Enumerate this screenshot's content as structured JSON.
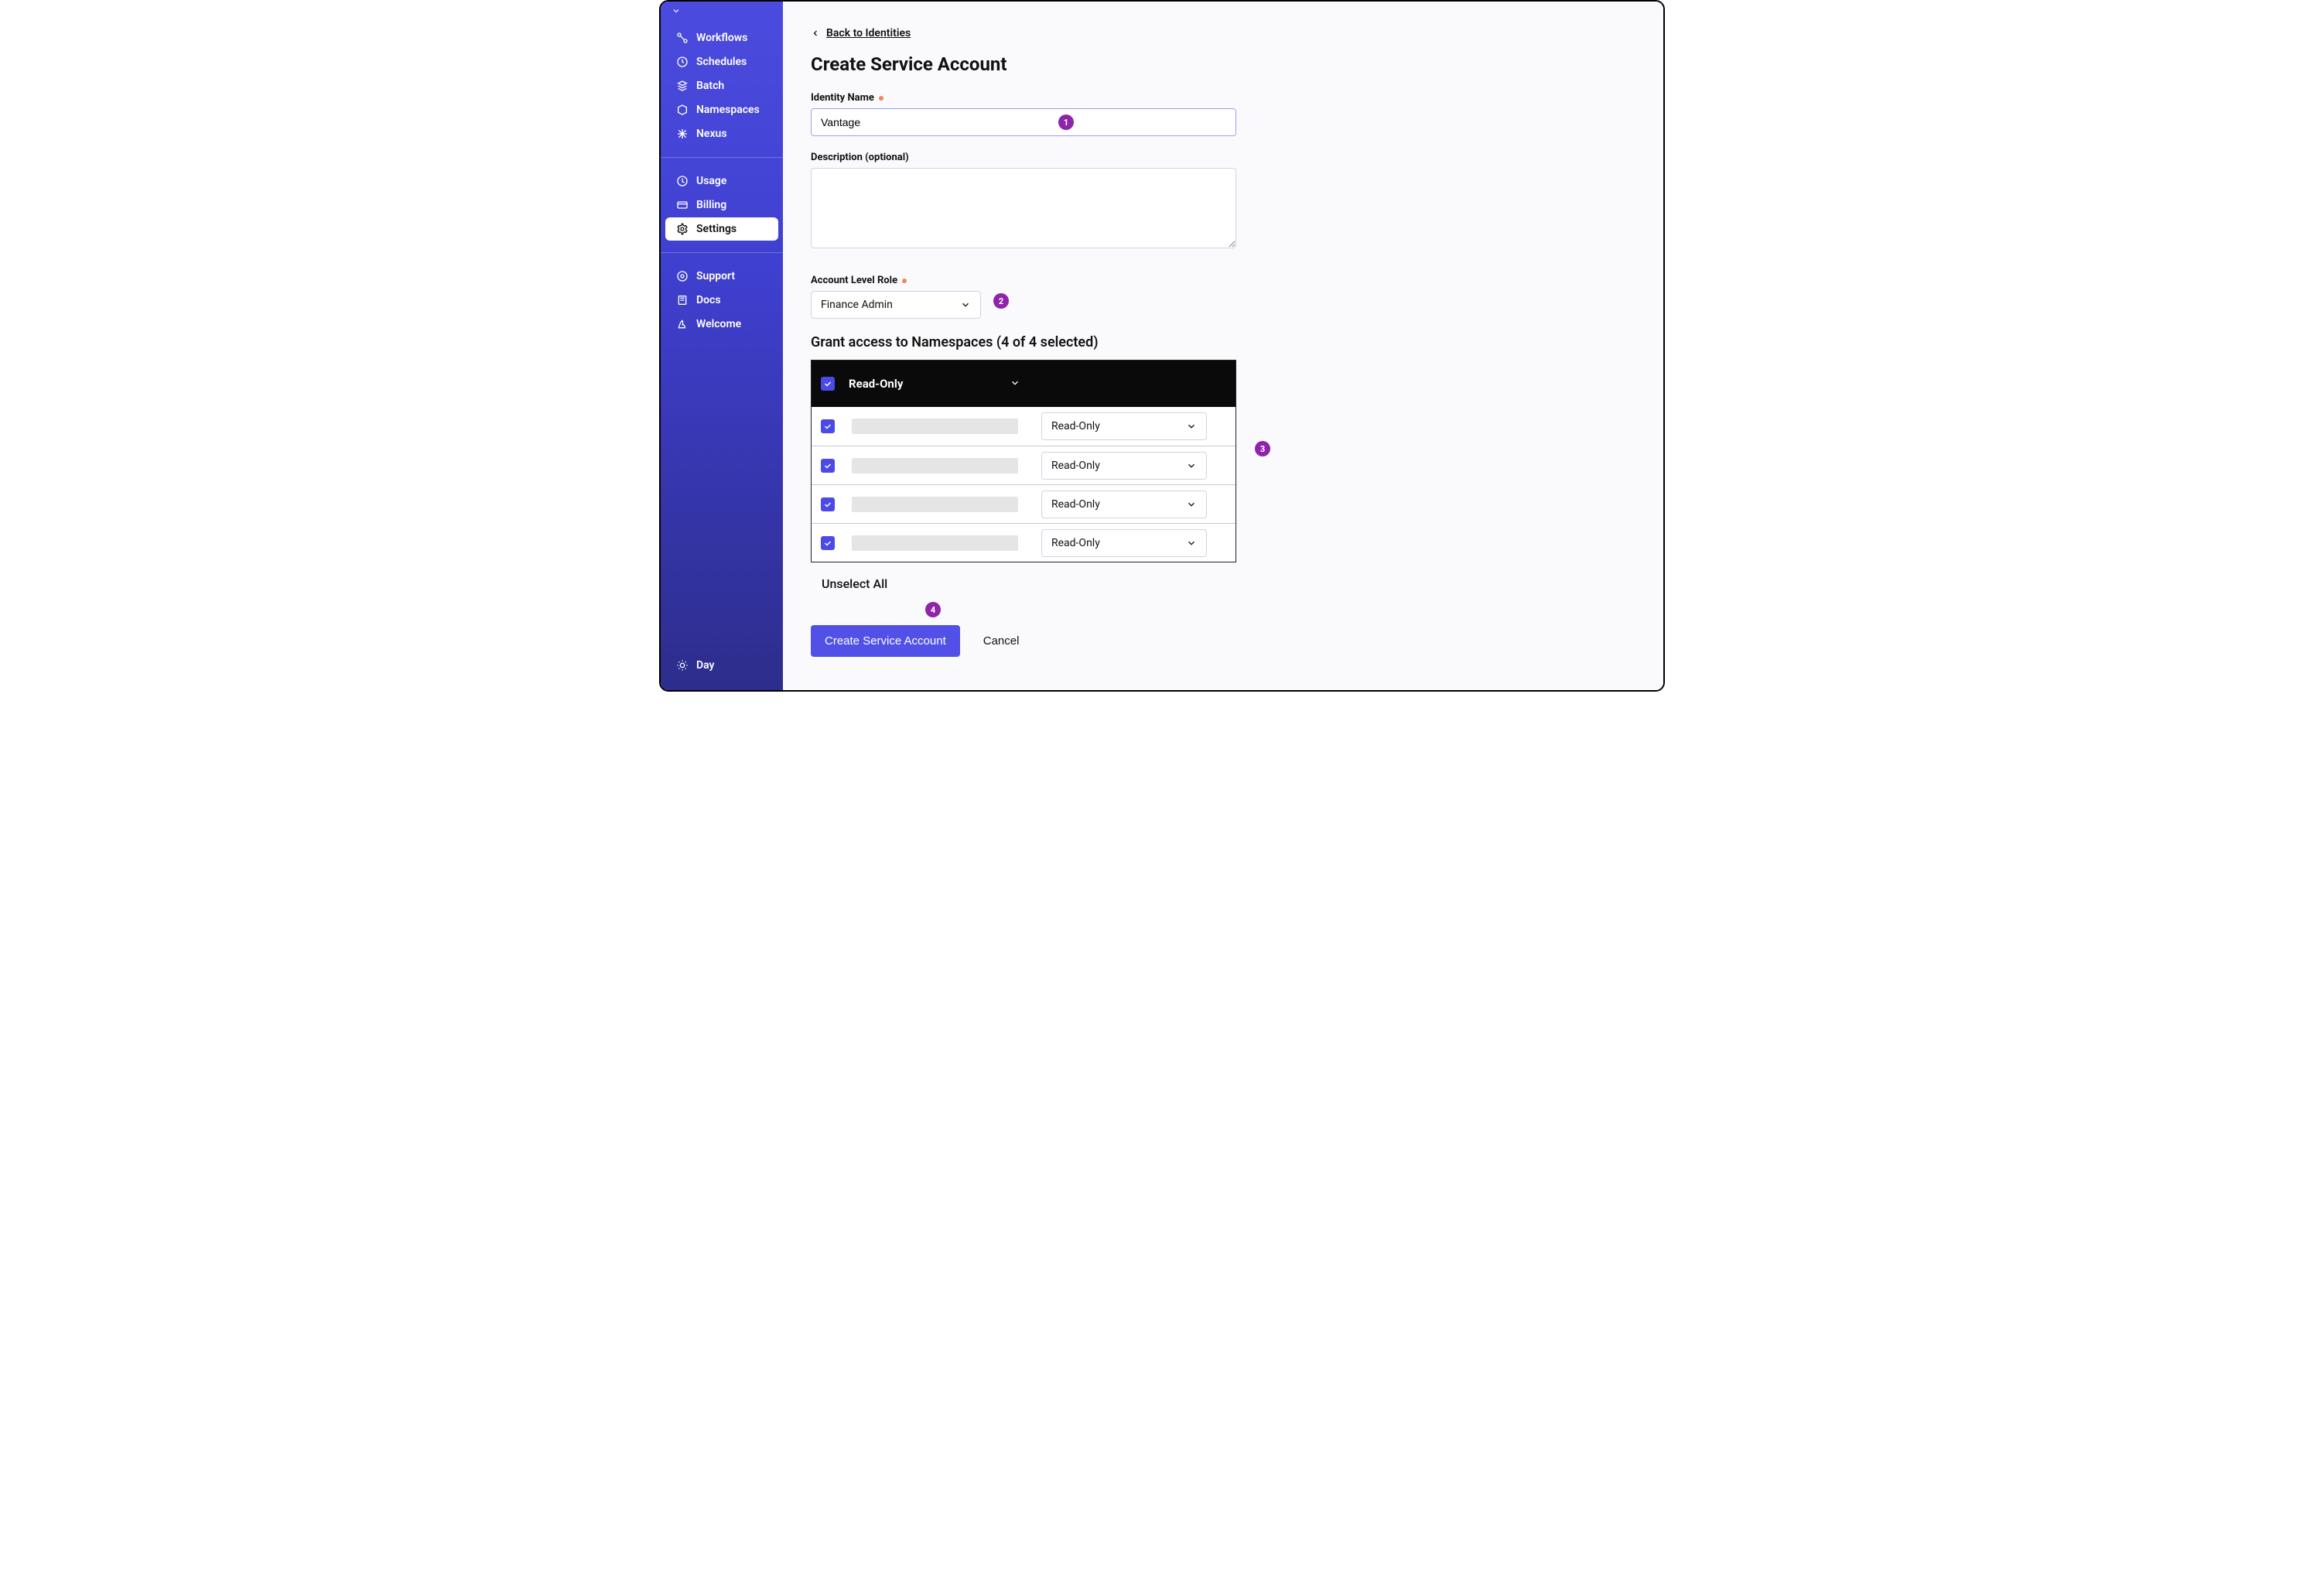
{
  "sidebar": {
    "groups": [
      [
        "Workflows",
        "Schedules",
        "Batch",
        "Namespaces",
        "Nexus"
      ],
      [
        "Usage",
        "Billing",
        "Settings"
      ],
      [
        "Support",
        "Docs",
        "Welcome"
      ]
    ],
    "active": "Settings",
    "theme_label": "Day"
  },
  "back_link": "Back to Identities",
  "page_title": "Create Service Account",
  "identity": {
    "label": "Identity Name",
    "value": "Vantage"
  },
  "description": {
    "label": "Description (optional)",
    "value": ""
  },
  "role": {
    "label": "Account Level Role",
    "value": "Finance Admin"
  },
  "namespaces": {
    "section_title": "Grant access to Namespaces (4 of 4 selected)",
    "header_label": "Read-Only",
    "rows": [
      {
        "perm": "Read-Only"
      },
      {
        "perm": "Read-Only"
      },
      {
        "perm": "Read-Only"
      },
      {
        "perm": "Read-Only"
      }
    ],
    "unselect_label": "Unselect All"
  },
  "actions": {
    "submit": "Create Service Account",
    "cancel": "Cancel"
  },
  "annotations": [
    "1",
    "2",
    "3",
    "4"
  ]
}
